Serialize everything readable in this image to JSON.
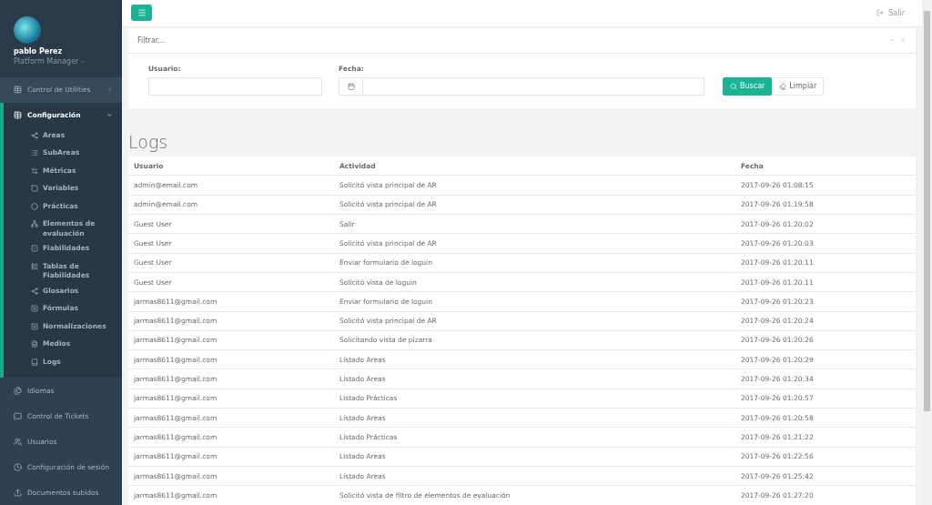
{
  "profile": {
    "name": "pablo Perez",
    "role": "Platform Manager"
  },
  "sidebar": {
    "items": [
      {
        "label": "Control de Utilities",
        "expanded": false
      },
      {
        "label": "Configuración",
        "expanded": true,
        "children": [
          {
            "label": "Areas"
          },
          {
            "label": "SubAreas"
          },
          {
            "label": "Métricas"
          },
          {
            "label": "Variables"
          },
          {
            "label": "Prácticas"
          },
          {
            "label": "Elementos de evaluación"
          },
          {
            "label": "Fiabilidades"
          },
          {
            "label": "Tablas de Fiabilidades"
          },
          {
            "label": "Glosarios"
          },
          {
            "label": "Fórmulas"
          },
          {
            "label": "Normalizaciones"
          },
          {
            "label": "Medios"
          },
          {
            "label": "Logs"
          }
        ]
      },
      {
        "label": "Idiomas"
      },
      {
        "label": "Control de Tickets"
      },
      {
        "label": "Usuarios"
      },
      {
        "label": "Configuración de sesión"
      },
      {
        "label": "Documentos subidos"
      }
    ]
  },
  "topbar": {
    "logout": "Salir"
  },
  "filter": {
    "title": "Filtrar...",
    "fields": [
      {
        "label": "Usuario:"
      },
      {
        "label": "Fecha:"
      }
    ],
    "search_button": "Buscar",
    "clear_button": "Limpiar"
  },
  "page_title": "Logs",
  "table": {
    "columns": [
      "Usuario",
      "Actividad",
      "Fecha"
    ],
    "rows": [
      [
        "admin@email.com",
        "Solicitó vista principal de AR",
        "2017-09-26 01:08:15"
      ],
      [
        "admin@email.com",
        "Solicitó vista principal de AR",
        "2017-09-26 01:19:58"
      ],
      [
        "Guest User",
        "Salir",
        "2017-09-26 01:20:02"
      ],
      [
        "Guest User",
        "Solicitó vista principal de AR",
        "2017-09-26 01:20:03"
      ],
      [
        "Guest User",
        "Enviar formulario de loguin",
        "2017-09-26 01:20:11"
      ],
      [
        "Guest User",
        "Solicitó vista de loguin",
        "2017-09-26 01:20:11"
      ],
      [
        "jarmas8611@gmail.com",
        "Enviar formulario de loguin",
        "2017-09-26 01:20:23"
      ],
      [
        "jarmas8611@gmail.com",
        "Solicitó vista principal de AR",
        "2017-09-26 01:20:24"
      ],
      [
        "jarmas8611@gmail.com",
        "Solicitando vista de pizarra",
        "2017-09-26 01:20:26"
      ],
      [
        "jarmas8611@gmail.com",
        "Listado Areas",
        "2017-09-26 01:20:29"
      ],
      [
        "jarmas8611@gmail.com",
        "Listado Areas",
        "2017-09-26 01:20:34"
      ],
      [
        "jarmas8611@gmail.com",
        "Listado Prácticas",
        "2017-09-26 01:20:57"
      ],
      [
        "jarmas8611@gmail.com",
        "Listado Areas",
        "2017-09-26 01:20:58"
      ],
      [
        "jarmas8611@gmail.com",
        "Listado Prácticas",
        "2017-09-26 01:21:22"
      ],
      [
        "jarmas8611@gmail.com",
        "Listado Areas",
        "2017-09-26 01:22:56"
      ],
      [
        "jarmas8611@gmail.com",
        "Listado Areas",
        "2017-09-26 01:25:42"
      ],
      [
        "jarmas8611@gmail.com",
        "Solicitó vista de filtro de elementos de evaluación",
        "2017-09-26 01:27:20"
      ]
    ]
  }
}
